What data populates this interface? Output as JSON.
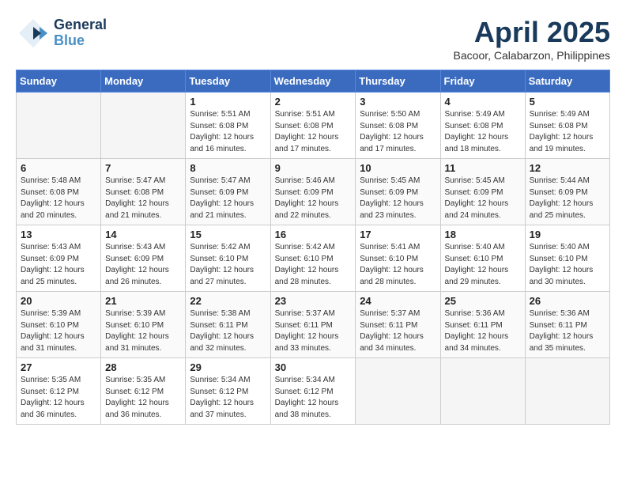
{
  "header": {
    "logo_line1": "General",
    "logo_line2": "Blue",
    "month_title": "April 2025",
    "location": "Bacoor, Calabarzon, Philippines"
  },
  "weekdays": [
    "Sunday",
    "Monday",
    "Tuesday",
    "Wednesday",
    "Thursday",
    "Friday",
    "Saturday"
  ],
  "weeks": [
    [
      {
        "day": "",
        "empty": true
      },
      {
        "day": "",
        "empty": true
      },
      {
        "day": "1",
        "sunrise": "5:51 AM",
        "sunset": "6:08 PM",
        "daylight": "12 hours and 16 minutes."
      },
      {
        "day": "2",
        "sunrise": "5:51 AM",
        "sunset": "6:08 PM",
        "daylight": "12 hours and 17 minutes."
      },
      {
        "day": "3",
        "sunrise": "5:50 AM",
        "sunset": "6:08 PM",
        "daylight": "12 hours and 17 minutes."
      },
      {
        "day": "4",
        "sunrise": "5:49 AM",
        "sunset": "6:08 PM",
        "daylight": "12 hours and 18 minutes."
      },
      {
        "day": "5",
        "sunrise": "5:49 AM",
        "sunset": "6:08 PM",
        "daylight": "12 hours and 19 minutes."
      }
    ],
    [
      {
        "day": "6",
        "sunrise": "5:48 AM",
        "sunset": "6:08 PM",
        "daylight": "12 hours and 20 minutes."
      },
      {
        "day": "7",
        "sunrise": "5:47 AM",
        "sunset": "6:08 PM",
        "daylight": "12 hours and 21 minutes."
      },
      {
        "day": "8",
        "sunrise": "5:47 AM",
        "sunset": "6:09 PM",
        "daylight": "12 hours and 21 minutes."
      },
      {
        "day": "9",
        "sunrise": "5:46 AM",
        "sunset": "6:09 PM",
        "daylight": "12 hours and 22 minutes."
      },
      {
        "day": "10",
        "sunrise": "5:45 AM",
        "sunset": "6:09 PM",
        "daylight": "12 hours and 23 minutes."
      },
      {
        "day": "11",
        "sunrise": "5:45 AM",
        "sunset": "6:09 PM",
        "daylight": "12 hours and 24 minutes."
      },
      {
        "day": "12",
        "sunrise": "5:44 AM",
        "sunset": "6:09 PM",
        "daylight": "12 hours and 25 minutes."
      }
    ],
    [
      {
        "day": "13",
        "sunrise": "5:43 AM",
        "sunset": "6:09 PM",
        "daylight": "12 hours and 25 minutes."
      },
      {
        "day": "14",
        "sunrise": "5:43 AM",
        "sunset": "6:09 PM",
        "daylight": "12 hours and 26 minutes."
      },
      {
        "day": "15",
        "sunrise": "5:42 AM",
        "sunset": "6:10 PM",
        "daylight": "12 hours and 27 minutes."
      },
      {
        "day": "16",
        "sunrise": "5:42 AM",
        "sunset": "6:10 PM",
        "daylight": "12 hours and 28 minutes."
      },
      {
        "day": "17",
        "sunrise": "5:41 AM",
        "sunset": "6:10 PM",
        "daylight": "12 hours and 28 minutes."
      },
      {
        "day": "18",
        "sunrise": "5:40 AM",
        "sunset": "6:10 PM",
        "daylight": "12 hours and 29 minutes."
      },
      {
        "day": "19",
        "sunrise": "5:40 AM",
        "sunset": "6:10 PM",
        "daylight": "12 hours and 30 minutes."
      }
    ],
    [
      {
        "day": "20",
        "sunrise": "5:39 AM",
        "sunset": "6:10 PM",
        "daylight": "12 hours and 31 minutes."
      },
      {
        "day": "21",
        "sunrise": "5:39 AM",
        "sunset": "6:10 PM",
        "daylight": "12 hours and 31 minutes."
      },
      {
        "day": "22",
        "sunrise": "5:38 AM",
        "sunset": "6:11 PM",
        "daylight": "12 hours and 32 minutes."
      },
      {
        "day": "23",
        "sunrise": "5:37 AM",
        "sunset": "6:11 PM",
        "daylight": "12 hours and 33 minutes."
      },
      {
        "day": "24",
        "sunrise": "5:37 AM",
        "sunset": "6:11 PM",
        "daylight": "12 hours and 34 minutes."
      },
      {
        "day": "25",
        "sunrise": "5:36 AM",
        "sunset": "6:11 PM",
        "daylight": "12 hours and 34 minutes."
      },
      {
        "day": "26",
        "sunrise": "5:36 AM",
        "sunset": "6:11 PM",
        "daylight": "12 hours and 35 minutes."
      }
    ],
    [
      {
        "day": "27",
        "sunrise": "5:35 AM",
        "sunset": "6:12 PM",
        "daylight": "12 hours and 36 minutes."
      },
      {
        "day": "28",
        "sunrise": "5:35 AM",
        "sunset": "6:12 PM",
        "daylight": "12 hours and 36 minutes."
      },
      {
        "day": "29",
        "sunrise": "5:34 AM",
        "sunset": "6:12 PM",
        "daylight": "12 hours and 37 minutes."
      },
      {
        "day": "30",
        "sunrise": "5:34 AM",
        "sunset": "6:12 PM",
        "daylight": "12 hours and 38 minutes."
      },
      {
        "day": "",
        "empty": true
      },
      {
        "day": "",
        "empty": true
      },
      {
        "day": "",
        "empty": true
      }
    ]
  ],
  "labels": {
    "sunrise": "Sunrise: ",
    "sunset": "Sunset: ",
    "daylight": "Daylight: "
  }
}
